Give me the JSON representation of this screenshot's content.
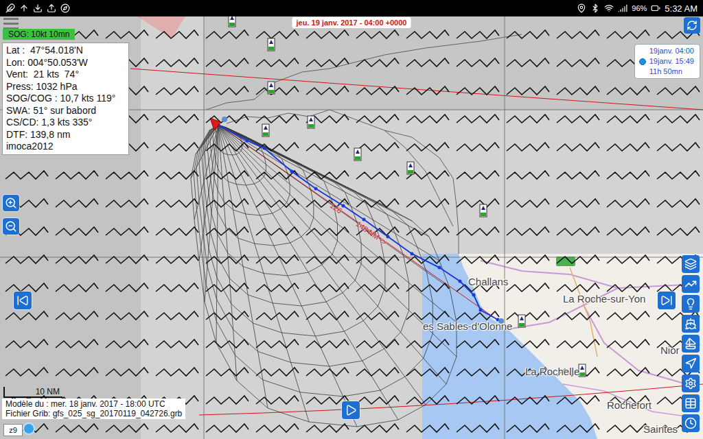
{
  "status_bar": {
    "battery": "96%",
    "time": "5:32 AM"
  },
  "top_banner": {
    "date": "jeu. 19 janv. 2017 - 04:00 +0000"
  },
  "green_label": "SOG: 10kt 10mn",
  "info_panel": {
    "lines": [
      "Lat :  47°54.018'N",
      "Lon: 004°50.053'W",
      "Vent:  21 kts  74°",
      "Press: 1032 hPa",
      "SOG/COG : 10,7 kts 119°",
      "SWA: 51° sur babord",
      "CS/CD: 1,3 kts 335°",
      "DTF: 139,8 nm",
      "imoca2012"
    ]
  },
  "time_box": {
    "items": [
      {
        "text": "19janv. 04:00",
        "selected": false
      },
      {
        "text": "19janv. 15:49",
        "selected": true
      }
    ],
    "duration": "11h 50mn"
  },
  "route": {
    "bearing": "126",
    "distance": "148 NM ->"
  },
  "places": [
    "Challans",
    "La Roche-sur-Yon",
    "es Sables-d'Olonne",
    "Nior",
    "La Rochelle",
    "Rochefort",
    "Saintes"
  ],
  "scale": "10 NM",
  "zoom": "z9",
  "footer": {
    "model": "Modèle du : mer. 18 janv. 2017 - 18:00 UTC",
    "grib": "Fichier Grib: gfs_025_sg_20170119_042726.grb"
  }
}
